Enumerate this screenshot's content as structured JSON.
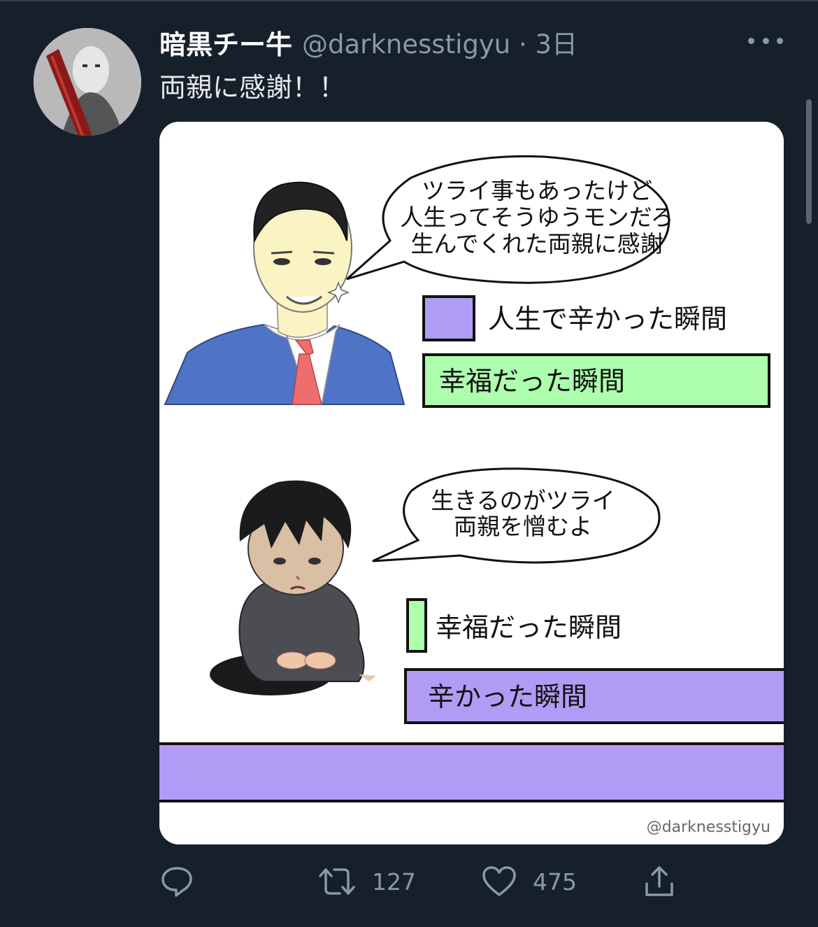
{
  "tweet": {
    "display_name": "暗黒チー牛",
    "handle": "@darknesstigyu",
    "time_separator": " · ",
    "time": "3日",
    "text": "両親に感謝！！"
  },
  "image": {
    "top_panel": {
      "speech_bubble": [
        "ツライ事もあったけど",
        "人生ってそうゆうモンだろ",
        "生んでくれた両親に感謝"
      ],
      "bar_small_label": "人生で辛かった瞬間",
      "bar_large_label": "幸福だった瞬間"
    },
    "bottom_panel": {
      "speech_bubble": [
        "生きるのがツライ",
        "両親を憎むよ"
      ],
      "bar_small_label": "幸福だった瞬間",
      "bar_large_label": "辛かった瞬間"
    },
    "watermark": "@darknesstigyu",
    "colors": {
      "purple": "#b19cf5",
      "green": "#adffad",
      "suit_blue": "#4f74c6",
      "tie_red": "#ee6e6e"
    }
  },
  "actions": {
    "reply_count": "",
    "retweet_count": "127",
    "like_count": "475",
    "share_count": ""
  }
}
